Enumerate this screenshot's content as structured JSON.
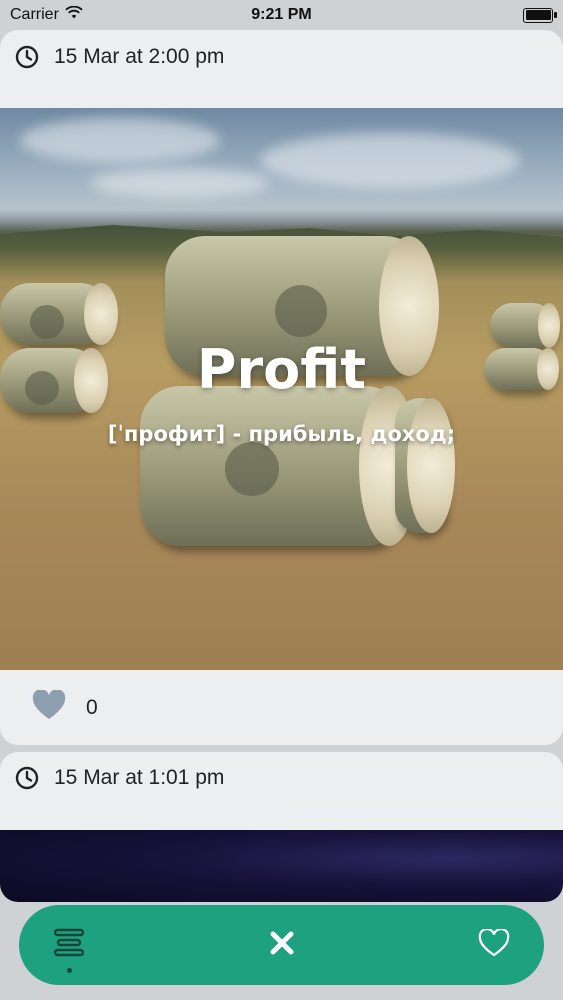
{
  "status_bar": {
    "carrier": "Carrier",
    "time": "9:21 PM"
  },
  "feed": {
    "posts": [
      {
        "timestamp": "15 Mar at 2:00 pm",
        "word": "Profit",
        "definition": "[ˈпрофит] - прибыль, доход;",
        "likes": "0",
        "image_icon": "money-rolls-field-image"
      },
      {
        "timestamp": "15 Mar at 1:01 pm",
        "image_icon": "night-sky-image"
      }
    ]
  },
  "bottom_nav": {
    "items": [
      {
        "icon": "list-icon",
        "active": true
      },
      {
        "icon": "close-icon"
      },
      {
        "icon": "heart-outline-icon"
      }
    ]
  },
  "colors": {
    "accent": "#1ea17e",
    "like_heart": "#8d9faf",
    "card_background": "#eceef0"
  }
}
